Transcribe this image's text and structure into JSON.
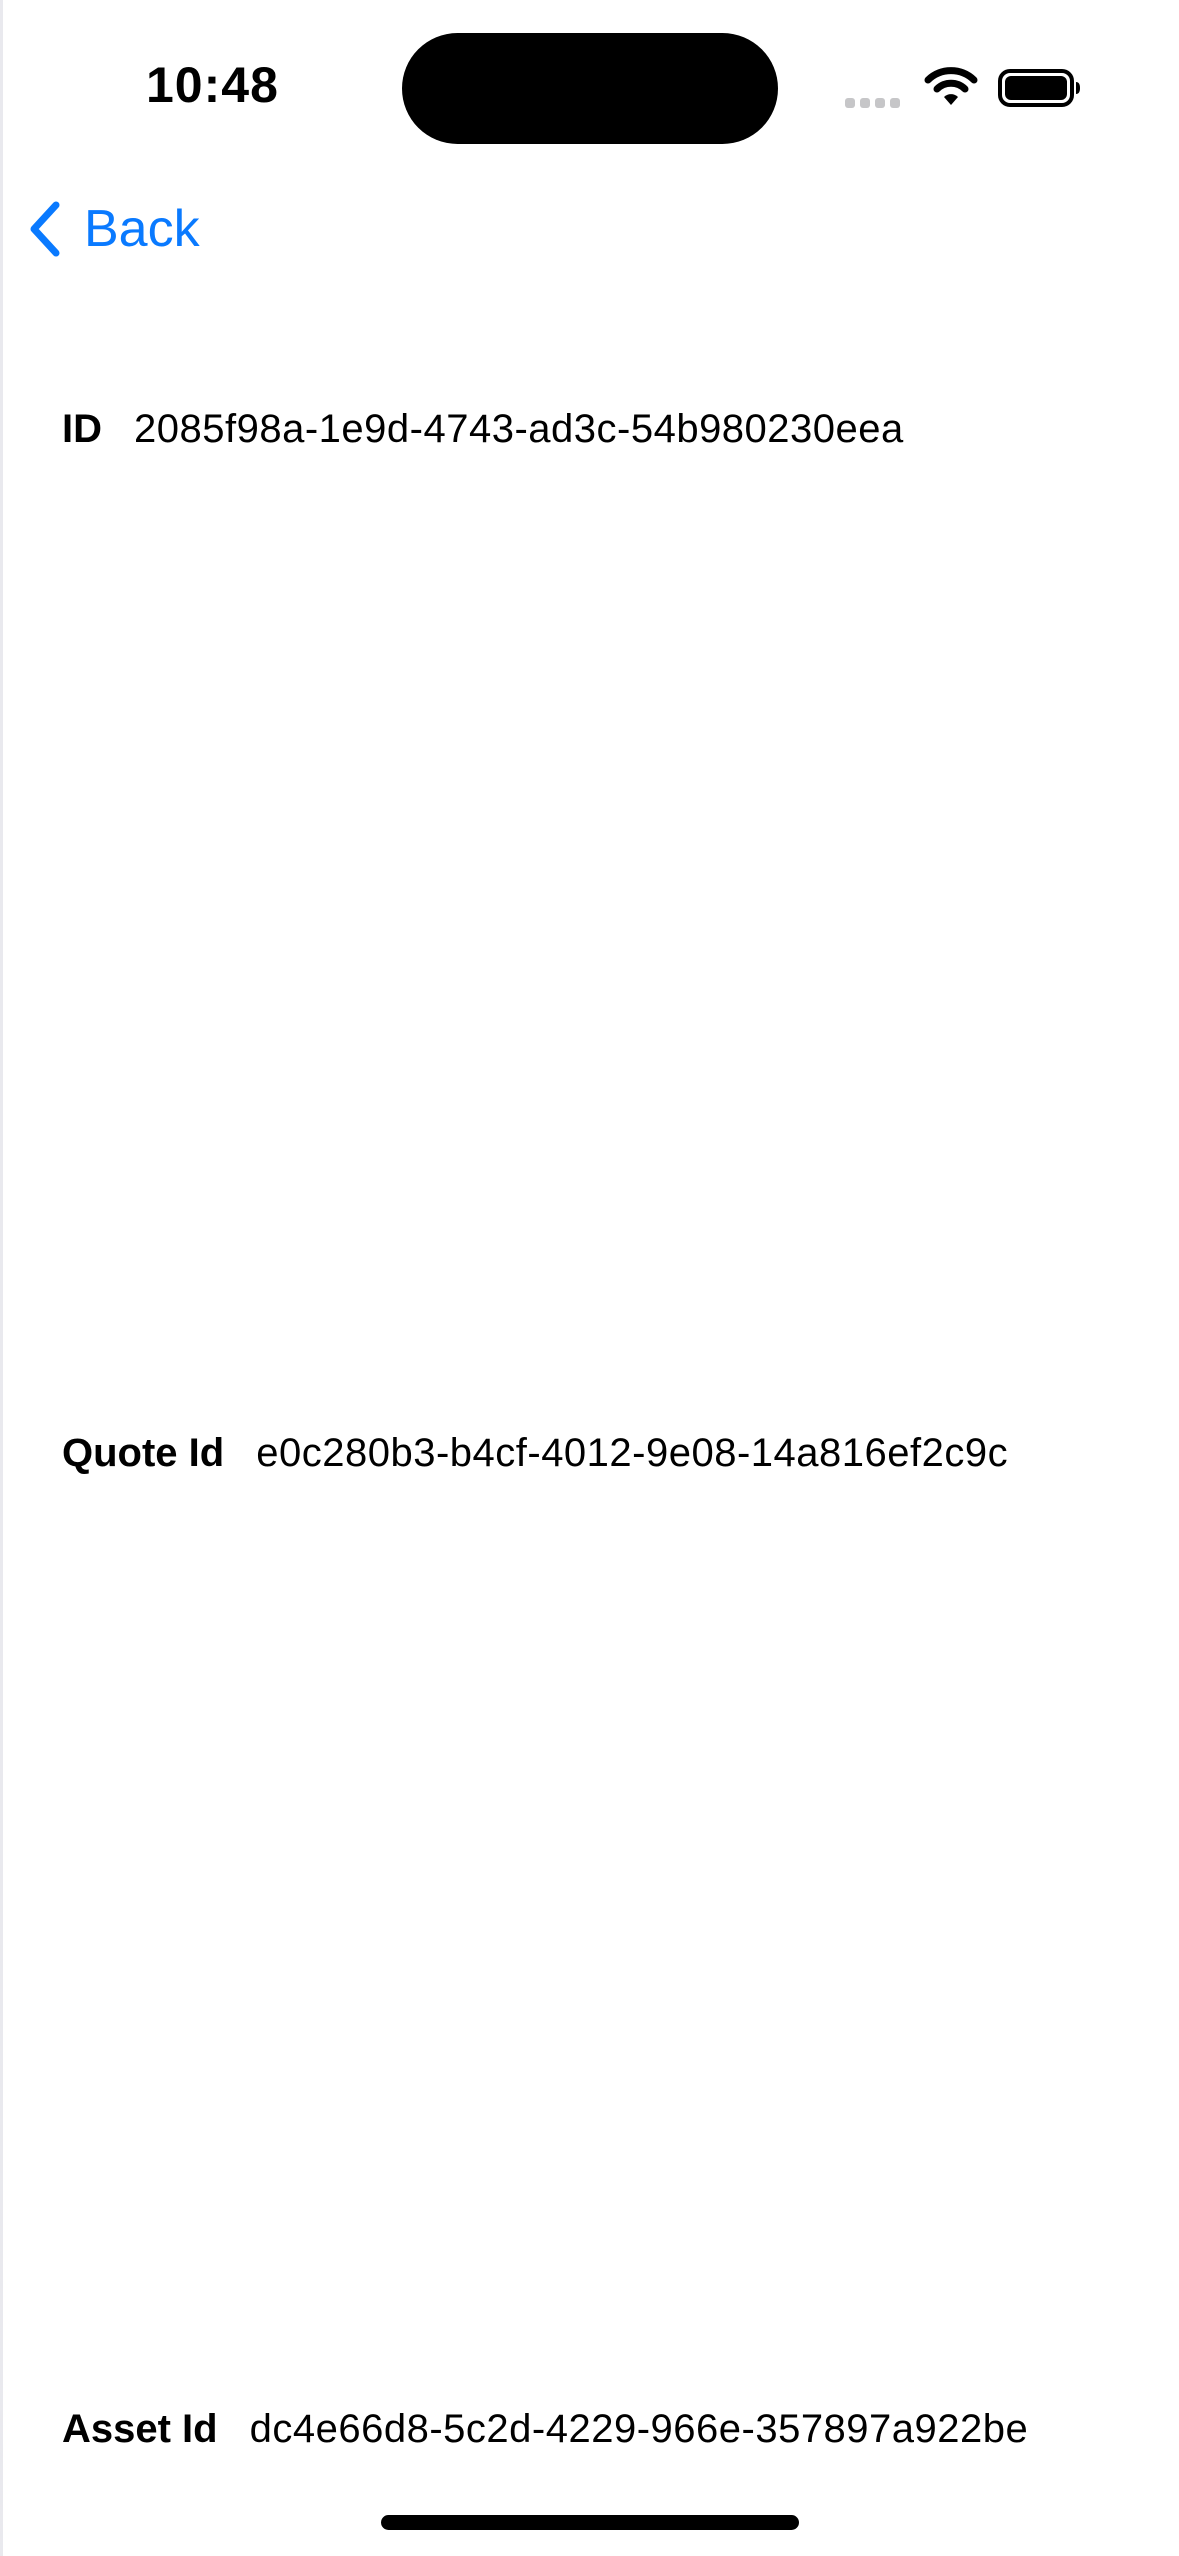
{
  "status_bar": {
    "time": "10:48",
    "icons": [
      "signal-icon",
      "wifi-icon",
      "battery-icon"
    ]
  },
  "nav": {
    "back_label": "Back",
    "back_icon": "chevron-left-icon",
    "accent_color": "#0a7aff"
  },
  "details": {
    "id": {
      "label": "ID",
      "value": "2085f98a-1e9d-4743-ad3c-54b980230eea"
    },
    "quote_id": {
      "label": "Quote Id",
      "value": "e0c280b3-b4cf-4012-9e08-14a816ef2c9c"
    },
    "asset_id": {
      "label": "Asset Id",
      "value": "dc4e66d8-5c2d-4229-966e-357897a922be"
    }
  }
}
